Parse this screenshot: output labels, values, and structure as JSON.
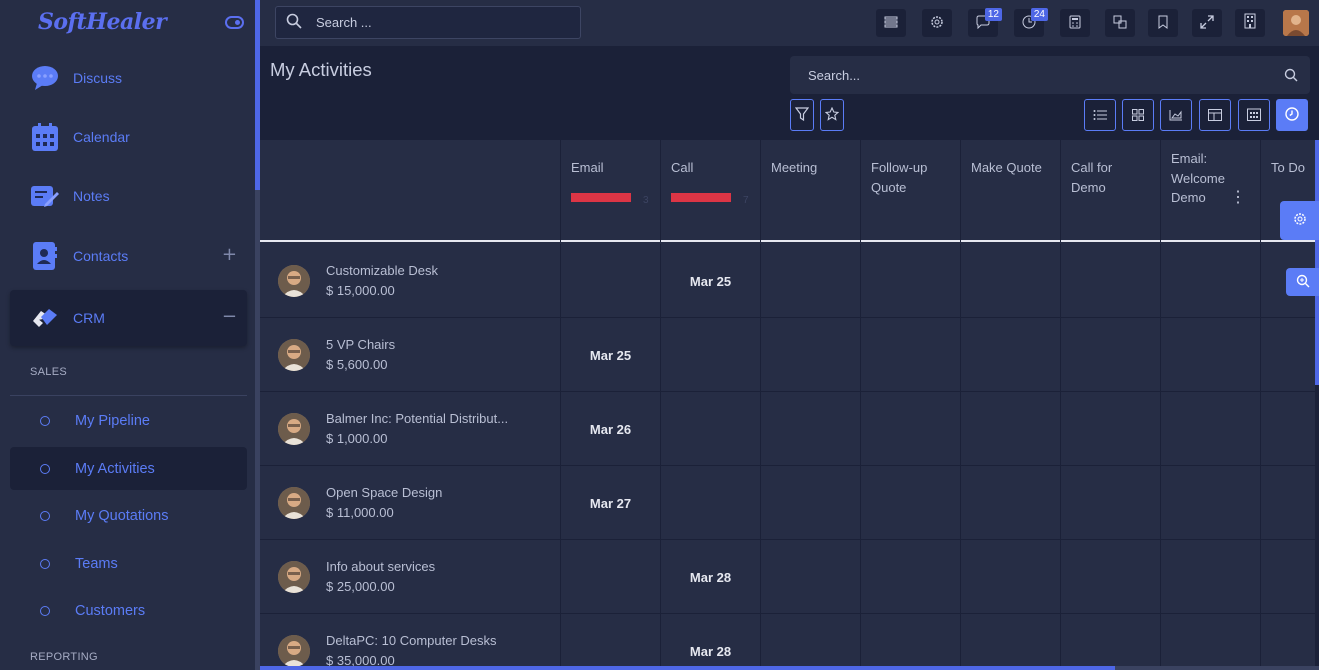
{
  "brand": {
    "logo_text": "SoftHealer"
  },
  "sidebar": {
    "apps": [
      {
        "label": "Discuss",
        "icon": "chat-bubble-icon"
      },
      {
        "label": "Calendar",
        "icon": "calendar-icon"
      },
      {
        "label": "Notes",
        "icon": "notes-icon"
      },
      {
        "label": "Contacts",
        "icon": "contacts-icon",
        "action": "+"
      },
      {
        "label": "CRM",
        "icon": "handshake-icon",
        "action": "−",
        "active": true
      }
    ],
    "sections": {
      "sales": "SALES",
      "reporting": "REPORTING"
    },
    "sales_menu": [
      {
        "label": "My Pipeline"
      },
      {
        "label": "My Activities",
        "active": true
      },
      {
        "label": "My Quotations"
      },
      {
        "label": "Teams"
      },
      {
        "label": "Customers"
      }
    ]
  },
  "topbar": {
    "search_placeholder": "Search ...",
    "messages_count": "12",
    "activities_count": "24"
  },
  "page": {
    "title": "My Activities",
    "search_placeholder": "Search..."
  },
  "grid": {
    "columns": [
      {
        "label": "Email",
        "count": "3",
        "has_bar": true
      },
      {
        "label": "Call",
        "count": "7",
        "has_bar": true
      },
      {
        "label": "Meeting"
      },
      {
        "label": "Follow-up Quote"
      },
      {
        "label": "Make Quote"
      },
      {
        "label": "Call for Demo"
      },
      {
        "label": "Email: Welcome Demo",
        "has_menu": true
      },
      {
        "label": "To Do"
      }
    ],
    "rows": [
      {
        "name": "Customizable Desk",
        "amount": "$ 15,000.00",
        "col": 1,
        "date": "Mar 25"
      },
      {
        "name": "5 VP Chairs",
        "amount": "$ 5,600.00",
        "col": 0,
        "date": "Mar 25"
      },
      {
        "name": "Balmer Inc: Potential Distribut...",
        "amount": "$ 1,000.00",
        "col": 0,
        "date": "Mar 26"
      },
      {
        "name": "Open Space Design",
        "amount": "$ 11,000.00",
        "col": 0,
        "date": "Mar 27"
      },
      {
        "name": "Info about services",
        "amount": "$ 25,000.00",
        "col": 1,
        "date": "Mar 28"
      },
      {
        "name": "DeltaPC: 10 Computer Desks",
        "amount": "$ 35,000.00",
        "col": 1,
        "date": "Mar 28"
      }
    ]
  },
  "colors": {
    "accent": "#5b7cf6",
    "sidebar_bg": "#262d45",
    "page_bg": "#1b2138",
    "bar_red": "#dc3545"
  }
}
